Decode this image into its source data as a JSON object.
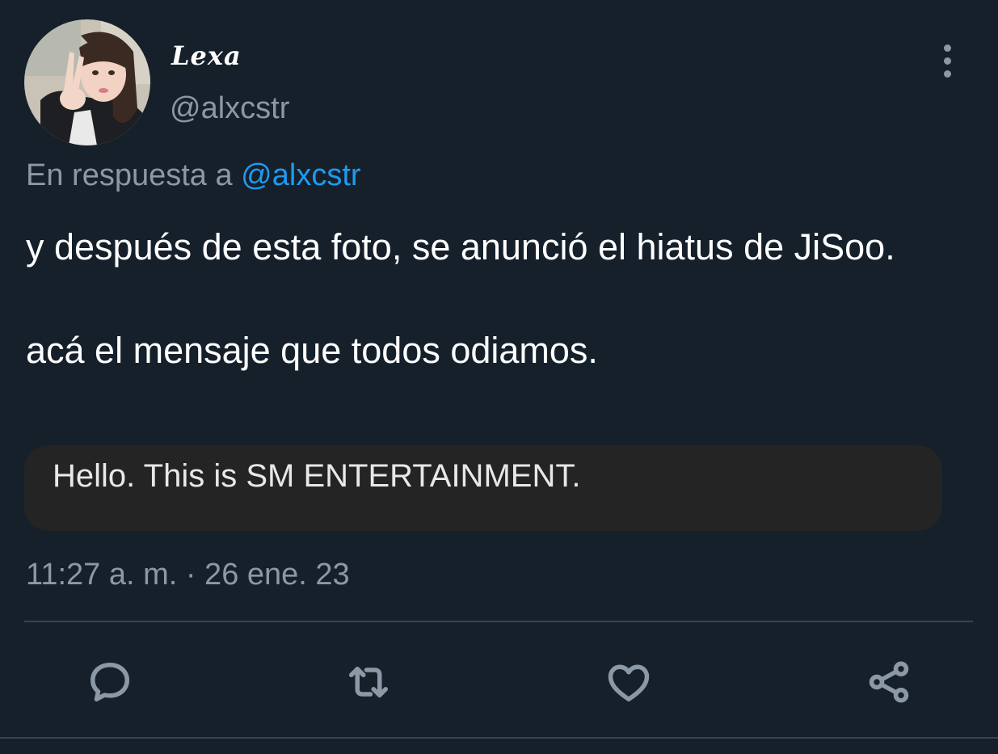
{
  "tweet": {
    "author": {
      "display_name": "Lexa",
      "handle": "@alxcstr"
    },
    "reply_to": {
      "prefix": "En respuesta a",
      "mention": "@alxcstr"
    },
    "text": {
      "line1": "y después de esta foto, se anunció el hiatus de JiSoo.",
      "line2": "acá el mensaje que todos odiamos."
    },
    "quoted_message": "Hello. This is SM ENTERTAINMENT.",
    "timestamp": "11:27 a. m. · 26 ene. 23"
  },
  "icons": {
    "more": "more-vertical-icon",
    "reply": "reply-icon",
    "retweet": "retweet-icon",
    "like": "heart-icon",
    "share": "share-icon"
  },
  "colors": {
    "background": "#15202b",
    "text_primary": "#ffffff",
    "text_secondary": "#8b98a5",
    "accent": "#1d9bf0",
    "quote_bg": "#242424",
    "divider": "#38444d"
  }
}
